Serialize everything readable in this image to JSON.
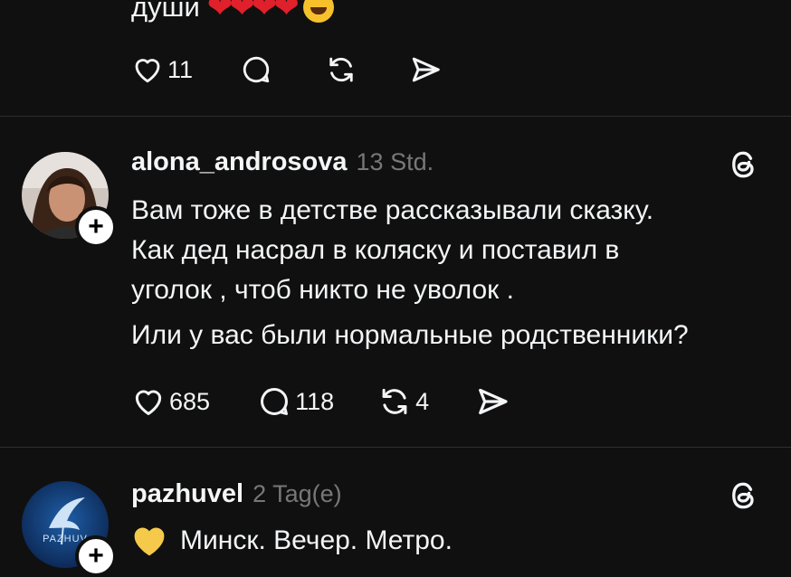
{
  "post1": {
    "text": "души",
    "like_count": "11"
  },
  "post2": {
    "username": "alona_androsova",
    "time": "13 Std.",
    "lines": [
      "Вам тоже в детстве рассказывали сказку.",
      "Как дед насрал в коляску и поставил в",
      "уголок , чтоб никто не уволок .",
      "Или у вас были нормальные родственники?"
    ],
    "like_count": "685",
    "reply_count": "118",
    "repost_count": "4"
  },
  "post3": {
    "username": "pazhuvel",
    "time": "2 Tag(e)",
    "text": "Минск. Вечер. Метро.",
    "avatar_label": "PAZHUV"
  },
  "plus": "+",
  "colors": {
    "background": "#101010",
    "text": "#f3f5f7",
    "muted": "#777777",
    "divider": "#2e2e2e",
    "heart_emoji": "#e0202b"
  }
}
